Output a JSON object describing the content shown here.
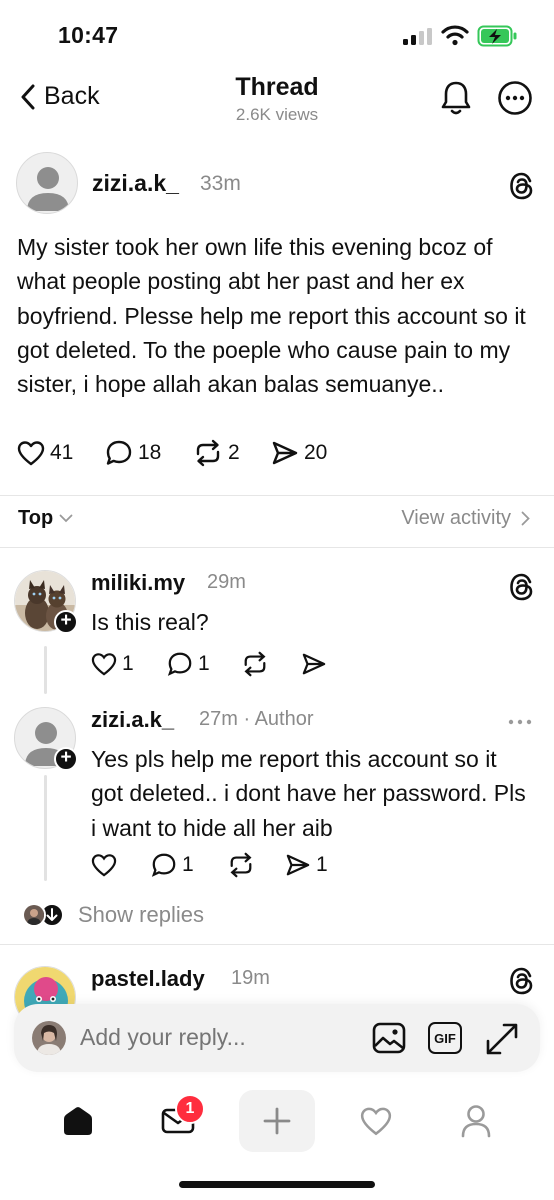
{
  "status_bar": {
    "time": "10:47"
  },
  "header": {
    "back_label": "Back",
    "title": "Thread",
    "views": "2.6K views"
  },
  "main_post": {
    "username": "zizi.a.k_",
    "time": "33m",
    "text": "My sister took her own life this evening bcoz of what people posting abt her past and her ex boyfriend. Plesse help me report this account so it got deleted. To the poeple who cause pain to my sister, i hope allah akan balas semuanye..",
    "likes": "41",
    "comments": "18",
    "reposts": "2",
    "shares": "20"
  },
  "sort": {
    "label": "Top",
    "view_activity": "View activity"
  },
  "replies": [
    {
      "username": "miliki.my",
      "meta": "29m",
      "text": "Is this real?",
      "likes": "1",
      "comments": "1"
    },
    {
      "username": "zizi.a.k_",
      "meta": "27m · Author",
      "text": "Yes pls help me report this account so it got deleted.. i dont have her password. Pls i want to hide all her aib",
      "comments": "1",
      "shares": "1"
    },
    {
      "username": "pastel.lady",
      "meta": "19m"
    }
  ],
  "show_replies": "Show replies",
  "composer": {
    "placeholder": "Add your reply...",
    "gif_label": "GIF"
  },
  "tab_bar": {
    "notification_count": "1"
  },
  "colors": {
    "text": "#101010",
    "muted": "#8a8a8a",
    "badge": "#ff2d3e",
    "battery": "#35c759"
  }
}
